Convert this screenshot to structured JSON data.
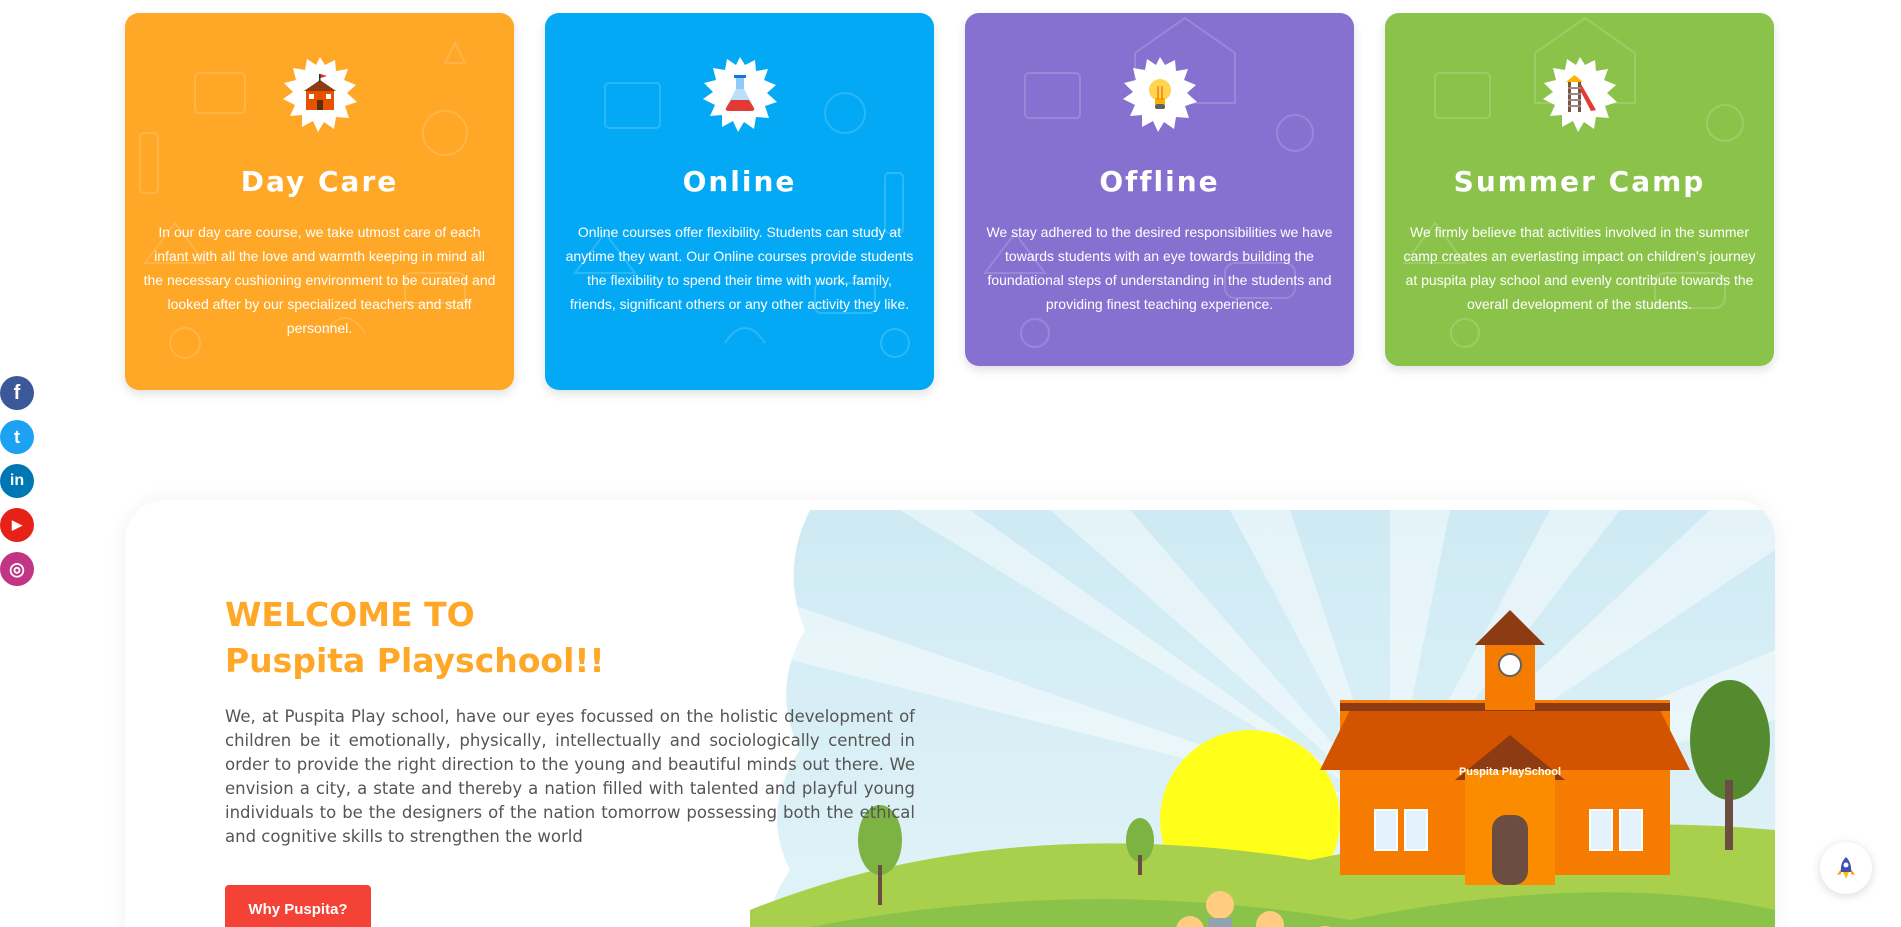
{
  "cards": [
    {
      "title": "Day Care",
      "text": "In our day care course, we take utmost care of each infant with all the love and warmth keeping in mind all the necessary cushioning environment to be curated and looked after by our specialized teachers and staff personnel.",
      "icon": "school-building-icon",
      "color": "#ffa726"
    },
    {
      "title": "Online",
      "text": "Online courses offer flexibility. Students can study at anytime they want. Our Online courses provide students the flexibility to spend their time with work, family, friends, significant others or any other activity they like.",
      "icon": "flask-icon",
      "color": "#03a9f4"
    },
    {
      "title": "Offline",
      "text": "We stay adhered to the desired responsibilities we have towards students with an eye towards building the foundational steps of understanding in the students and providing finest teaching experience.",
      "icon": "lightbulb-icon",
      "color": "#8671d1"
    },
    {
      "title": "Summer Camp",
      "text": "We firmly believe that activities involved in the summer camp creates an everlasting impact on children's journey at puspita play school and evenly contribute towards the overall development of the students.",
      "icon": "playground-slide-icon",
      "color": "#8bc34a"
    }
  ],
  "social": [
    {
      "name": "facebook-icon",
      "glyph": "f",
      "color": "#3b5998"
    },
    {
      "name": "twitter-icon",
      "glyph": "t",
      "color": "#1da1f2"
    },
    {
      "name": "linkedin-icon",
      "glyph": "in",
      "color": "#0077b5"
    },
    {
      "name": "youtube-icon",
      "glyph": "▶",
      "color": "#e62117"
    },
    {
      "name": "instagram-icon",
      "glyph": "◎",
      "color": "#c13584"
    }
  ],
  "welcome": {
    "heading_line1": "WELCOME TO",
    "heading_line2": "Puspita Playschool!!",
    "body": "We, at Puspita Play school, have our eyes focussed on the holistic development of children be it emotionally, physically, intellectually and sociologically centred in order to provide the right direction to the young and beautiful minds out there. We envision a city, a state and thereby a nation filled with talented and playful young individuals to be the designers of the nation tomorrow possessing both the ethical and cognitive skills to strengthen the world",
    "button_label": "Why Puspita?",
    "school_sign": "Puspita PlaySchool"
  },
  "back_to_top_icon": "rocket-icon",
  "colors": {
    "orange": "#ffa726",
    "blue": "#03a9f4",
    "purple": "#8671d1",
    "green": "#8bc34a",
    "red": "#f44336"
  }
}
